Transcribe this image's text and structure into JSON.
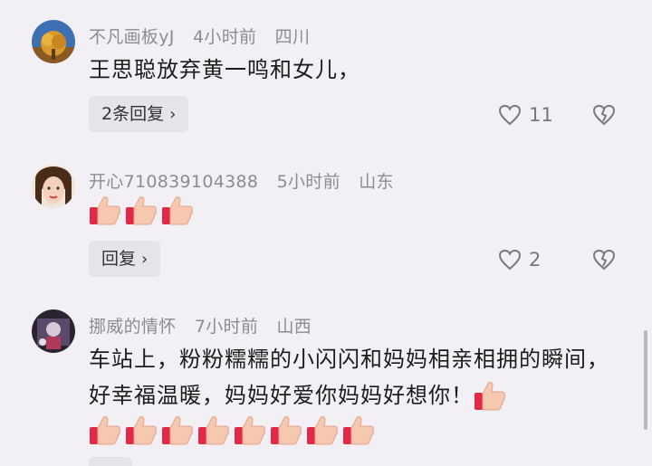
{
  "comments": [
    {
      "user": "不凡画板yJ",
      "time": "4小时前",
      "location": "四川",
      "text": "王思聪放弃黄一鸣和女儿，",
      "reply_label": "2条回复",
      "likes": "11"
    },
    {
      "user": "开心710839104388",
      "time": "5小时前",
      "location": "山东",
      "text": "",
      "thumbs": 3,
      "reply_label": "回复",
      "likes": "2"
    },
    {
      "user": "挪威的情怀",
      "time": "7小时前",
      "location": "山西",
      "text": "车站上，粉粉糯糯的小闪闪和妈妈相亲相拥的瞬间，好幸福温暖，妈妈好爱你妈妈好想你！",
      "thumbs_inline": 1,
      "thumbs": 8
    }
  ],
  "icons": {
    "like": "heart-outline-icon",
    "dislike": "broken-heart-icon",
    "thumbs": "thumbs-up-emoji",
    "chevron": "chevron-right-icon"
  }
}
